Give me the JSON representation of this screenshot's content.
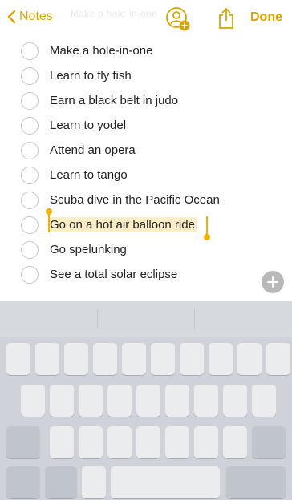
{
  "nav": {
    "back_label": "Notes",
    "done_label": "Done",
    "faint_title": "Make a hole-in-one"
  },
  "list": {
    "items": [
      {
        "label": "Make a hole-in-one",
        "checked": false
      },
      {
        "label": "Learn to fly fish",
        "checked": false
      },
      {
        "label": "Earn a black belt in judo",
        "checked": false
      },
      {
        "label": "Learn to yodel",
        "checked": false
      },
      {
        "label": "Attend an opera",
        "checked": false
      },
      {
        "label": "Learn to tango",
        "checked": false
      },
      {
        "label": "Scuba dive in the Pacific Ocean",
        "checked": false
      },
      {
        "label": "Go on a hot air balloon ride",
        "checked": false,
        "selected": true
      },
      {
        "label": "Go spelunking",
        "checked": false
      },
      {
        "label": "See a total solar eclipse",
        "checked": false
      }
    ]
  },
  "colors": {
    "accent": "#d9a400",
    "selection": "#fbeec6",
    "keyboard_bg": "#cfd3d9"
  },
  "icons": {
    "back": "chevron-left-icon",
    "collaborate": "add-person-icon",
    "share": "share-icon",
    "add": "plus-icon"
  }
}
